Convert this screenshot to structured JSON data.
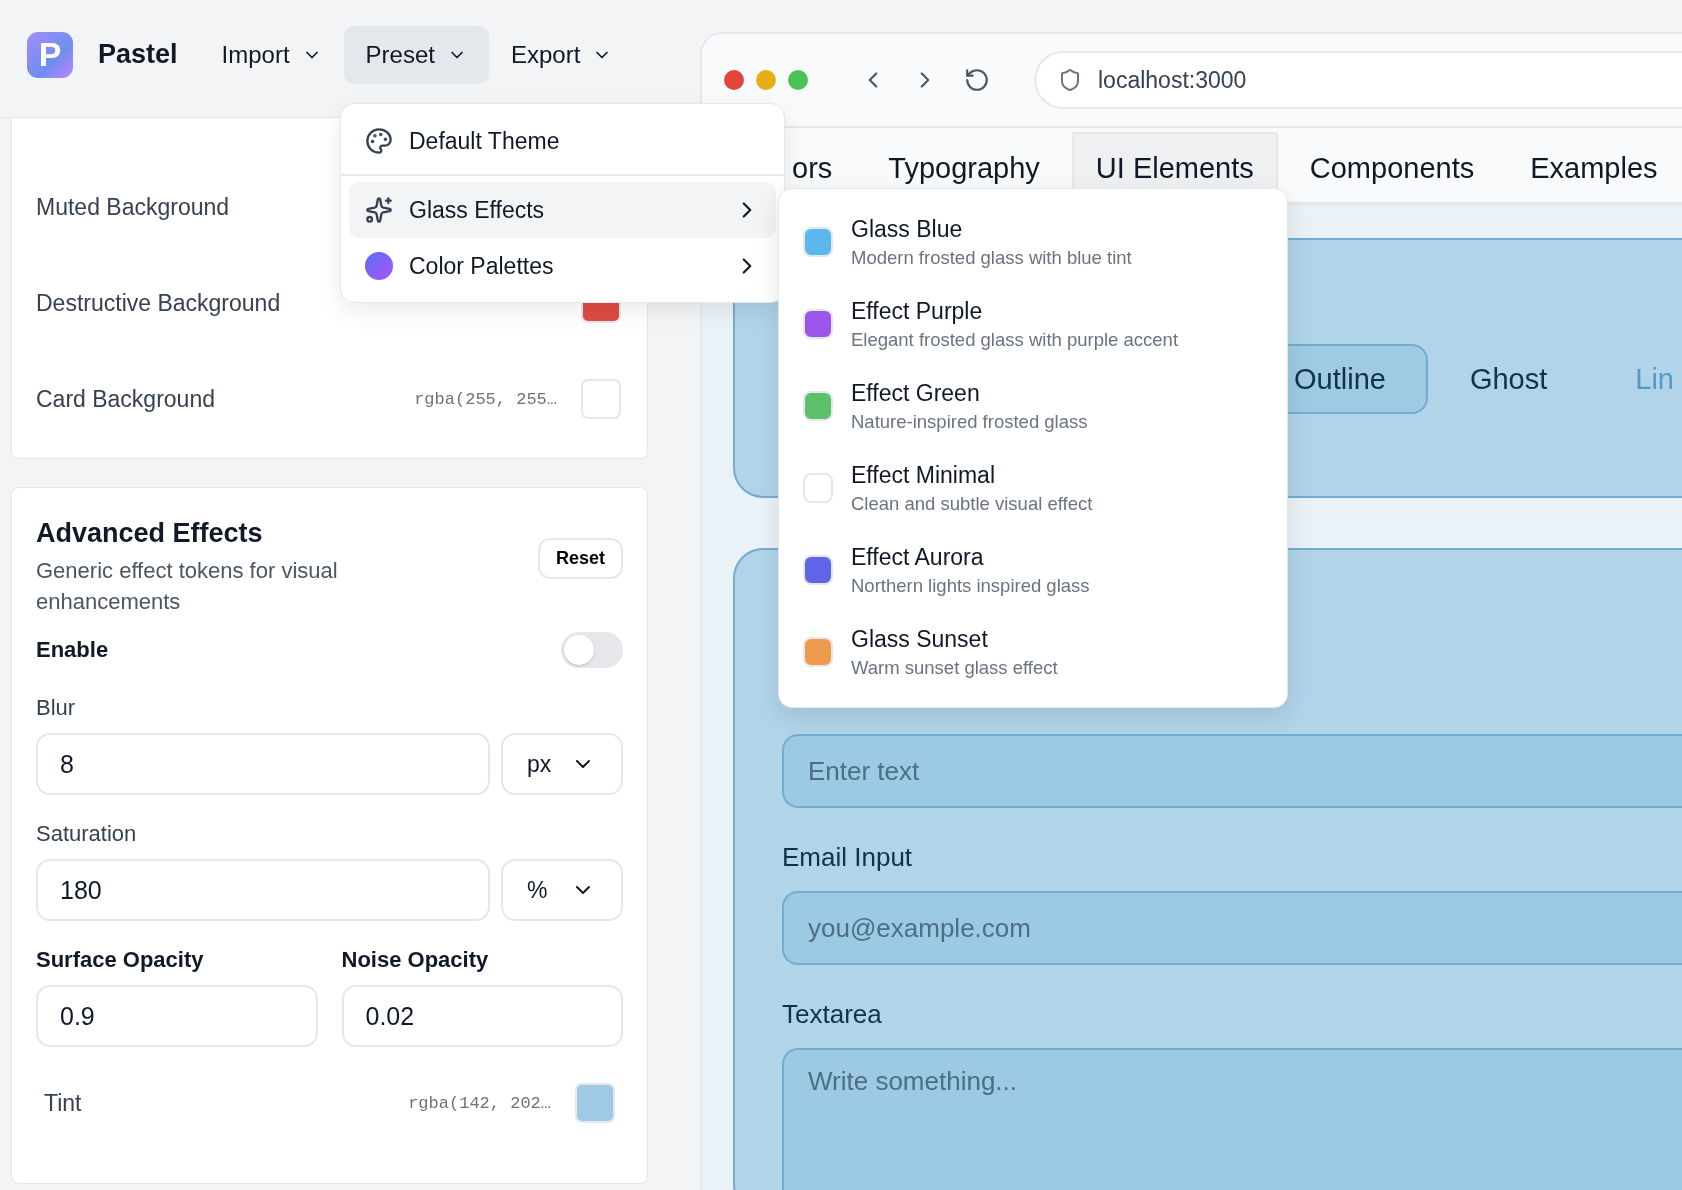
{
  "app": {
    "logo_letter": "P",
    "name": "Pastel"
  },
  "menu_bar": [
    {
      "label": "Import",
      "open": false
    },
    {
      "label": "Preset",
      "open": true
    },
    {
      "label": "Export",
      "open": false
    }
  ],
  "color_tokens": [
    {
      "label": "Muted Background"
    },
    {
      "label": "Destructive Background",
      "color": "#df4c45"
    },
    {
      "label": "Card Background",
      "value": "rgba(255, 255…",
      "color": "#ffffff"
    }
  ],
  "advanced_effects": {
    "title": "Advanced Effects",
    "description": "Generic effect tokens for visual enhancements",
    "reset_button": "Reset",
    "enable": {
      "label": "Enable",
      "on": false
    },
    "blur": {
      "label": "Blur",
      "value": "8",
      "unit": "px"
    },
    "saturation": {
      "label": "Saturation",
      "value": "180",
      "unit": "%"
    },
    "surface_opacity": {
      "label": "Surface Opacity",
      "value": "0.9"
    },
    "noise_opacity": {
      "label": "Noise Opacity",
      "value": "0.02"
    },
    "tint": {
      "label": "Tint",
      "value": "rgba(142, 202…",
      "color": "#9ecae6"
    }
  },
  "preset_menu": {
    "items": [
      {
        "kind": "palette",
        "label": "Default Theme",
        "submenu": false,
        "selected": false
      },
      {
        "kind": "sparkles",
        "label": "Glass Effects",
        "submenu": true,
        "selected": true
      },
      {
        "kind": "gradient",
        "label": "Color Palettes",
        "submenu": true,
        "selected": false
      }
    ]
  },
  "glass_effects_menu": [
    {
      "title": "Glass Blue",
      "description": "Modern frosted glass with blue tint",
      "color": "#5bb8ef"
    },
    {
      "title": "Effect Purple",
      "description": "Elegant frosted glass with purple accent",
      "color": "#9b55e8"
    },
    {
      "title": "Effect Green",
      "description": "Nature-inspired frosted glass",
      "color": "#5cc16a"
    },
    {
      "title": "Effect Minimal",
      "description": "Clean and subtle visual effect",
      "color": "#ffffff"
    },
    {
      "title": "Effect Aurora",
      "description": "Northern lights inspired glass",
      "color": "#6264e8"
    },
    {
      "title": "Glass Sunset",
      "description": "Warm sunset glass effect",
      "color": "#ee9a4e"
    }
  ],
  "browser": {
    "url": "localhost:3000",
    "tabs": [
      {
        "label": "ors",
        "selected": false
      },
      {
        "label": "Typography",
        "selected": false
      },
      {
        "label": "UI Elements",
        "selected": true
      },
      {
        "label": "Components",
        "selected": false
      },
      {
        "label": "Examples",
        "selected": false
      }
    ],
    "buttons": [
      {
        "kind": "outline",
        "label": "Outline"
      },
      {
        "kind": "ghost",
        "label": "Ghost"
      },
      {
        "kind": "link",
        "label": "Lin"
      }
    ],
    "fields": [
      {
        "kind": "input",
        "placeholder": "Enter text"
      },
      {
        "kind": "input",
        "label": "Email Input",
        "placeholder": "you@example.com"
      },
      {
        "kind": "textarea",
        "label": "Textarea",
        "placeholder": "Write something..."
      }
    ]
  }
}
